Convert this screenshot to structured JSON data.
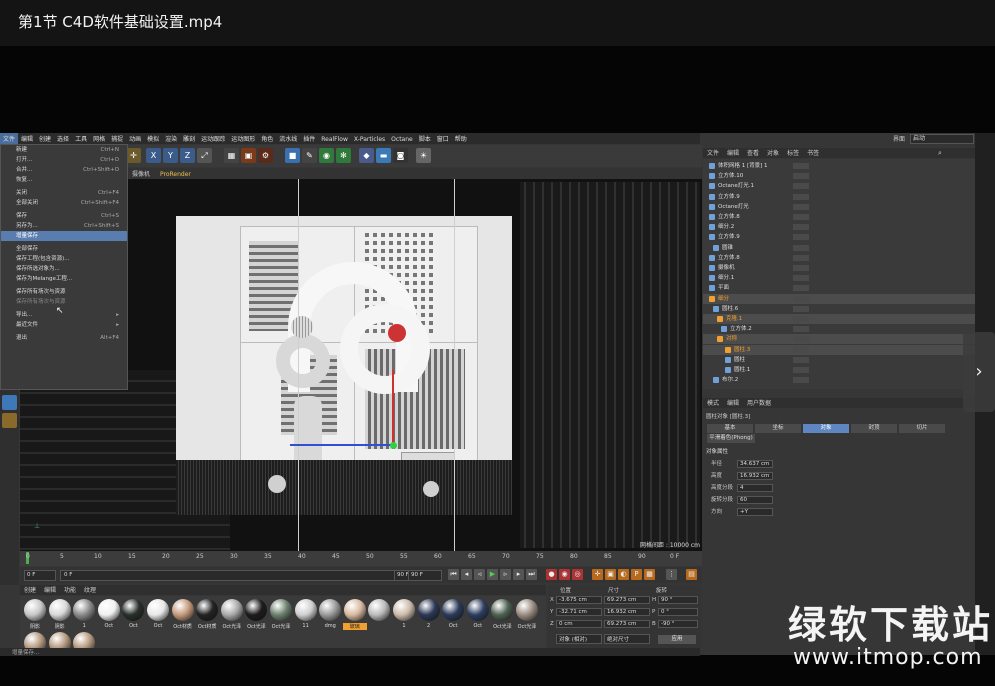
{
  "video": {
    "title": "第1节 C4D软件基础设置.mp4"
  },
  "menubar": {
    "items": [
      "文件",
      "编辑",
      "创建",
      "选择",
      "工具",
      "网格",
      "捕捉",
      "动画",
      "模拟",
      "渲染",
      "雕刻",
      "运动跟踪",
      "运动图形",
      "角色",
      "流水线",
      "插件",
      "RealFlow",
      "X-Particles",
      "Octane",
      "脚本",
      "窗口",
      "帮助"
    ],
    "layout_label": "界面",
    "layout_value": "启动"
  },
  "filemenu": {
    "items": [
      {
        "label": "新建",
        "shortcut": "Ctrl+N"
      },
      {
        "label": "打开...",
        "shortcut": "Ctrl+O"
      },
      {
        "label": "合并...",
        "shortcut": "Ctrl+Shift+O"
      },
      {
        "label": "恢复...",
        "shortcut": ""
      },
      {
        "label": "关闭",
        "shortcut": "Ctrl+F4"
      },
      {
        "label": "全部关闭",
        "shortcut": "Ctrl+Shift+F4"
      },
      {
        "label": "保存",
        "shortcut": "Ctrl+S"
      },
      {
        "label": "另存为...",
        "shortcut": "Ctrl+Shift+S"
      },
      {
        "label": "增量保存",
        "shortcut": ""
      },
      {
        "label": "全部保存",
        "shortcut": ""
      },
      {
        "label": "保存工程(包含资源)...",
        "shortcut": ""
      },
      {
        "label": "保存所选对象为...",
        "shortcut": ""
      },
      {
        "label": "保存为Melange工程...",
        "shortcut": ""
      },
      {
        "label": "保存所有场次与资源",
        "shortcut": ""
      },
      {
        "label": "保存所有场次与资源",
        "shortcut": ""
      },
      {
        "label": "导出...",
        "shortcut": ""
      },
      {
        "label": "最近文件",
        "shortcut": ""
      },
      {
        "label": "退出",
        "shortcut": "Alt+F4"
      }
    ]
  },
  "viewport": {
    "tabs": [
      "摄像机",
      "ProRender"
    ],
    "hud": "网格间距 : 10000 cm"
  },
  "timeline": {
    "ticks": [
      "0",
      "5",
      "10",
      "15",
      "20",
      "25",
      "30",
      "35",
      "40",
      "45",
      "50",
      "55",
      "60",
      "65",
      "70",
      "75",
      "80",
      "85",
      "90"
    ],
    "frame_end": "0 F"
  },
  "transport": {
    "start": "0 F",
    "current": "0 F",
    "end": "90 F",
    "end2": "90 F"
  },
  "materials": {
    "tabs": [
      "创建",
      "编辑",
      "功能",
      "纹理"
    ],
    "items": [
      {
        "label": "阴影",
        "color": "#c7c7c7"
      },
      {
        "label": "阴影",
        "color": "#d8d8d8"
      },
      {
        "label": "1",
        "color": "#8a8a8a"
      },
      {
        "label": "Oct",
        "color": "#f0f0f0"
      },
      {
        "label": "Oct",
        "color": "#28302b"
      },
      {
        "label": "Oct",
        "color": "#e8e8e8"
      },
      {
        "label": "Oct材质",
        "color": "#c49a7c"
      },
      {
        "label": "Oct材质",
        "color": "#222"
      },
      {
        "label": "Oct光泽",
        "color": "#aaa"
      },
      {
        "label": "Oct光泽",
        "color": "#1c1c1c"
      },
      {
        "label": "Oct光泽",
        "color": "#6c806f"
      },
      {
        "label": "11",
        "color": "#cfcfcf"
      },
      {
        "label": "dmg",
        "color": "#9a9a9a"
      },
      {
        "label": "玻璃",
        "color": "#d8b9a0"
      },
      {
        "label": "",
        "color": "#bbb"
      },
      {
        "label": "1",
        "color": "#ccbbaa"
      },
      {
        "label": "2",
        "color": "#2c3755"
      },
      {
        "label": "Oct",
        "color": "#2a3a58"
      },
      {
        "label": "Oct",
        "color": "#2d3d60"
      },
      {
        "label": "Oct光泽",
        "color": "#4e6252"
      },
      {
        "label": "Oct光泽",
        "color": "#9b8c80"
      }
    ]
  },
  "coords": {
    "headers": [
      "位置",
      "尺寸",
      "旋转"
    ],
    "rows": [
      {
        "axis": "X",
        "pos": "-3.675 cm",
        "size": "69.273 cm",
        "rotlbl": "H",
        "rot": "90 °"
      },
      {
        "axis": "Y",
        "pos": "-32.71 cm",
        "size": "16.932 cm",
        "rotlbl": "P",
        "rot": "0 °"
      },
      {
        "axis": "Z",
        "pos": "0 cm",
        "size": "69.273 cm",
        "rotlbl": "B",
        "rot": "-90 °"
      }
    ],
    "mode1": "对象 (相对)",
    "mode2": "绝对尺寸",
    "apply": "应用"
  },
  "status": {
    "text": "增量保存..."
  },
  "objectmanager": {
    "tabs": [
      "文件",
      "编辑",
      "查看",
      "对象",
      "标签",
      "书签"
    ],
    "rows": [
      {
        "name": "体积网格 1 [背景] 1",
        "indent": 6,
        "sel": false
      },
      {
        "name": "立方体.10",
        "indent": 6,
        "sel": false
      },
      {
        "name": "Octane灯光.1",
        "indent": 6,
        "sel": false
      },
      {
        "name": "立方体.9",
        "indent": 6,
        "sel": false
      },
      {
        "name": "Octane灯光",
        "indent": 6,
        "sel": false
      },
      {
        "name": "立方体.8",
        "indent": 6,
        "sel": false
      },
      {
        "name": "细分.2",
        "indent": 6,
        "sel": false
      },
      {
        "name": "立方体.9",
        "indent": 6,
        "sel": false
      },
      {
        "name": "圆锥",
        "indent": 10,
        "sel": false
      },
      {
        "name": "立方体.8",
        "indent": 6,
        "sel": false
      },
      {
        "name": "摄像机",
        "indent": 6,
        "sel": false
      },
      {
        "name": "细分.1",
        "indent": 6,
        "sel": false
      },
      {
        "name": "平面",
        "indent": 6,
        "sel": false
      },
      {
        "name": "细分",
        "indent": 6,
        "sel": true
      },
      {
        "name": "圆柱.6",
        "indent": 10,
        "sel": false
      },
      {
        "name": "克隆.1",
        "indent": 14,
        "sel": true
      },
      {
        "name": "立方体.2",
        "indent": 18,
        "sel": false
      },
      {
        "name": "对称",
        "indent": 14,
        "sel": true
      },
      {
        "name": "圆柱.3",
        "indent": 22,
        "sel": true
      },
      {
        "name": "圆柱",
        "indent": 22,
        "sel": false
      },
      {
        "name": "圆柱.1",
        "indent": 22,
        "sel": false
      },
      {
        "name": "布尔.2",
        "indent": 10,
        "sel": false
      }
    ]
  },
  "attributes": {
    "tabs": [
      "模式",
      "编辑",
      "用户数据"
    ],
    "object_title": "圆柱对象 [圆柱.3]",
    "subtabs": [
      "基本",
      "坐标",
      "对象",
      "封顶",
      "切片"
    ],
    "active_subtab": 2,
    "phong": "平滑着色(Phong)",
    "section": "对象属性",
    "fields": [
      {
        "label": "半径",
        "value": "34.637 cm"
      },
      {
        "label": "高度",
        "value": "16.932 cm"
      },
      {
        "label": "高度分段",
        "value": "4"
      },
      {
        "label": "旋转分段",
        "value": "60"
      },
      {
        "label": "方向",
        "value": "+Y"
      }
    ]
  },
  "watermark": {
    "line1": "绿软下载站",
    "line2": "www.itmop.com"
  }
}
